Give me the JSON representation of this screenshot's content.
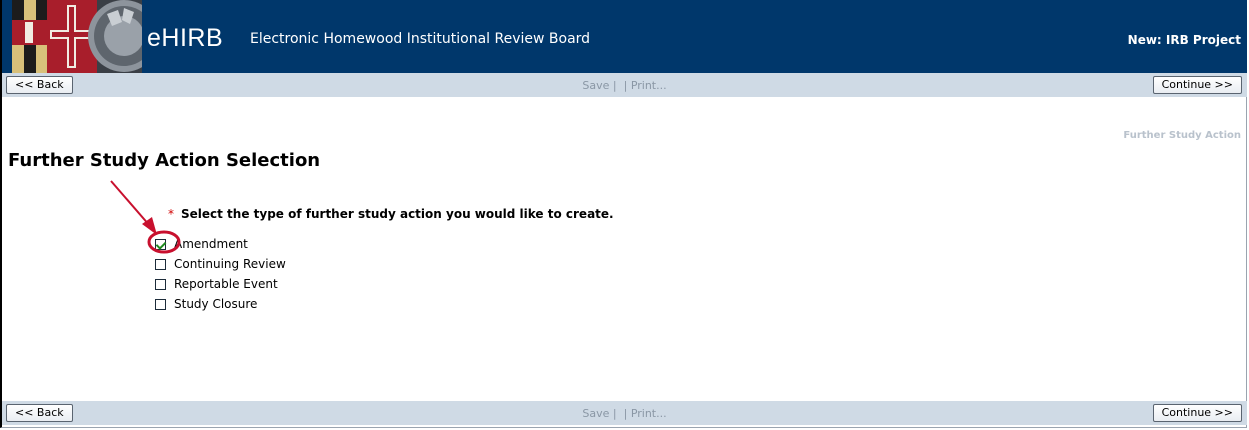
{
  "header": {
    "brand": "eHIRB",
    "subtitle": "Electronic Homewood Institutional Review Board",
    "project": "New: IRB Project",
    "background": "#00376b"
  },
  "toolbar": {
    "back_label": "<< Back",
    "continue_label": "Continue >>",
    "save_label": "Save",
    "print_label": "Print..."
  },
  "content": {
    "breadcrumb": "Further Study Action",
    "title": "Further Study Action Selection",
    "required_mark": "*",
    "question": "Select the type of further study action you would like to create.",
    "options": [
      {
        "label": "Amendment",
        "checked": true
      },
      {
        "label": "Continuing Review",
        "checked": false
      },
      {
        "label": "Reportable Event",
        "checked": false
      },
      {
        "label": "Study Closure",
        "checked": false
      }
    ]
  },
  "annotation": {
    "color": "#c8102e"
  }
}
